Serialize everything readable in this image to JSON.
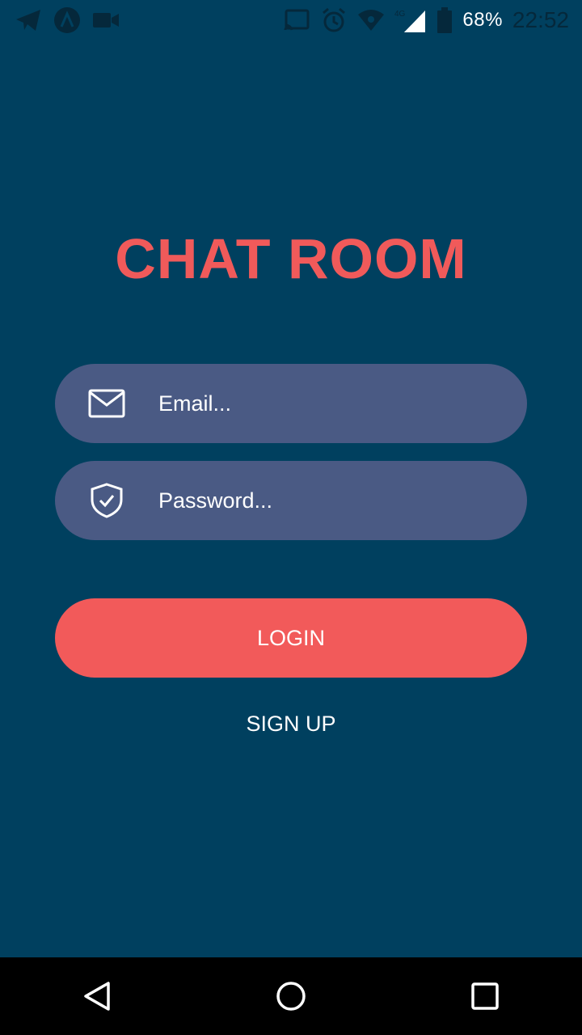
{
  "status_bar": {
    "battery_percent": "68%",
    "time": "22:52",
    "network": "4G",
    "icons": [
      "telegram-icon",
      "android-icon",
      "video-icon",
      "cast-icon",
      "alarm-icon",
      "wifi-icon",
      "signal-icon",
      "battery-icon"
    ]
  },
  "login": {
    "title": "CHAT ROOM",
    "email_placeholder": "Email...",
    "password_placeholder": "Password...",
    "login_label": "LOGIN",
    "signup_label": "SIGN UP"
  },
  "colors": {
    "background": "#00405f",
    "title": "#f05a5a",
    "field": "#4a5a84",
    "button": "#f25a5a",
    "text": "#ffffff"
  },
  "nav_bar": {
    "icons": [
      "back-icon",
      "home-icon",
      "recents-icon"
    ]
  }
}
